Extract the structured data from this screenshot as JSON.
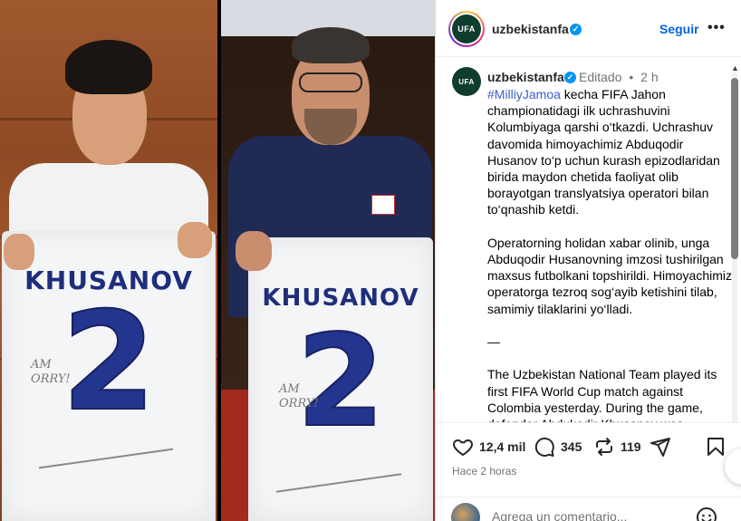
{
  "media": {
    "left_jersey_name": "KHUSANOV",
    "left_jersey_number": "2",
    "right_jersey_name": "KHUSANOV",
    "right_jersey_number": "2"
  },
  "header": {
    "username": "uzbekistanfa",
    "follow_label": "Seguir",
    "more_label": "•••"
  },
  "caption": {
    "username": "uzbekistanfa",
    "edited_label": "Editado",
    "separator": "•",
    "time_ago": "2 h",
    "hashtag": "#MilliyJamoa",
    "text": " kecha FIFA Jahon championatidagi ilk uchrashuvini Kolumbiyaga qarshi o‘tkazdi. Uchrashuv davomida himoyachimiz Abduqodir Husanov to‘p uchun kurash epizodlaridan birida maydon chetida faoliyat olib borayotgan translyatsiya operatori bilan to‘qnashib ketdi.\n\nOperatorning holidan xabar olinib, unga Abduqodir Husanovning imzosi tushirilgan maxsus futbolkani topshirildi. Himoyachimiz operatorga tezroq sog‘ayib ketishini tilab, samimiy tilaklarini yo‘lladi.\n\n—\n\nThe Uzbekistan National Team played its first FIFA World Cup match against Colombia yesterday. During the game, defender Abdukodir Khusanov was"
  },
  "actions": {
    "likes": "12,4 mil",
    "comments": "345",
    "reposts": "119",
    "posted": "Hace 2 horas"
  },
  "add_comment": {
    "placeholder": "Agrega un comentario..."
  },
  "colors": {
    "link": "#0064e0",
    "hashtag": "#3c5fc9",
    "verified": "#0095f6",
    "muted": "#737373"
  }
}
